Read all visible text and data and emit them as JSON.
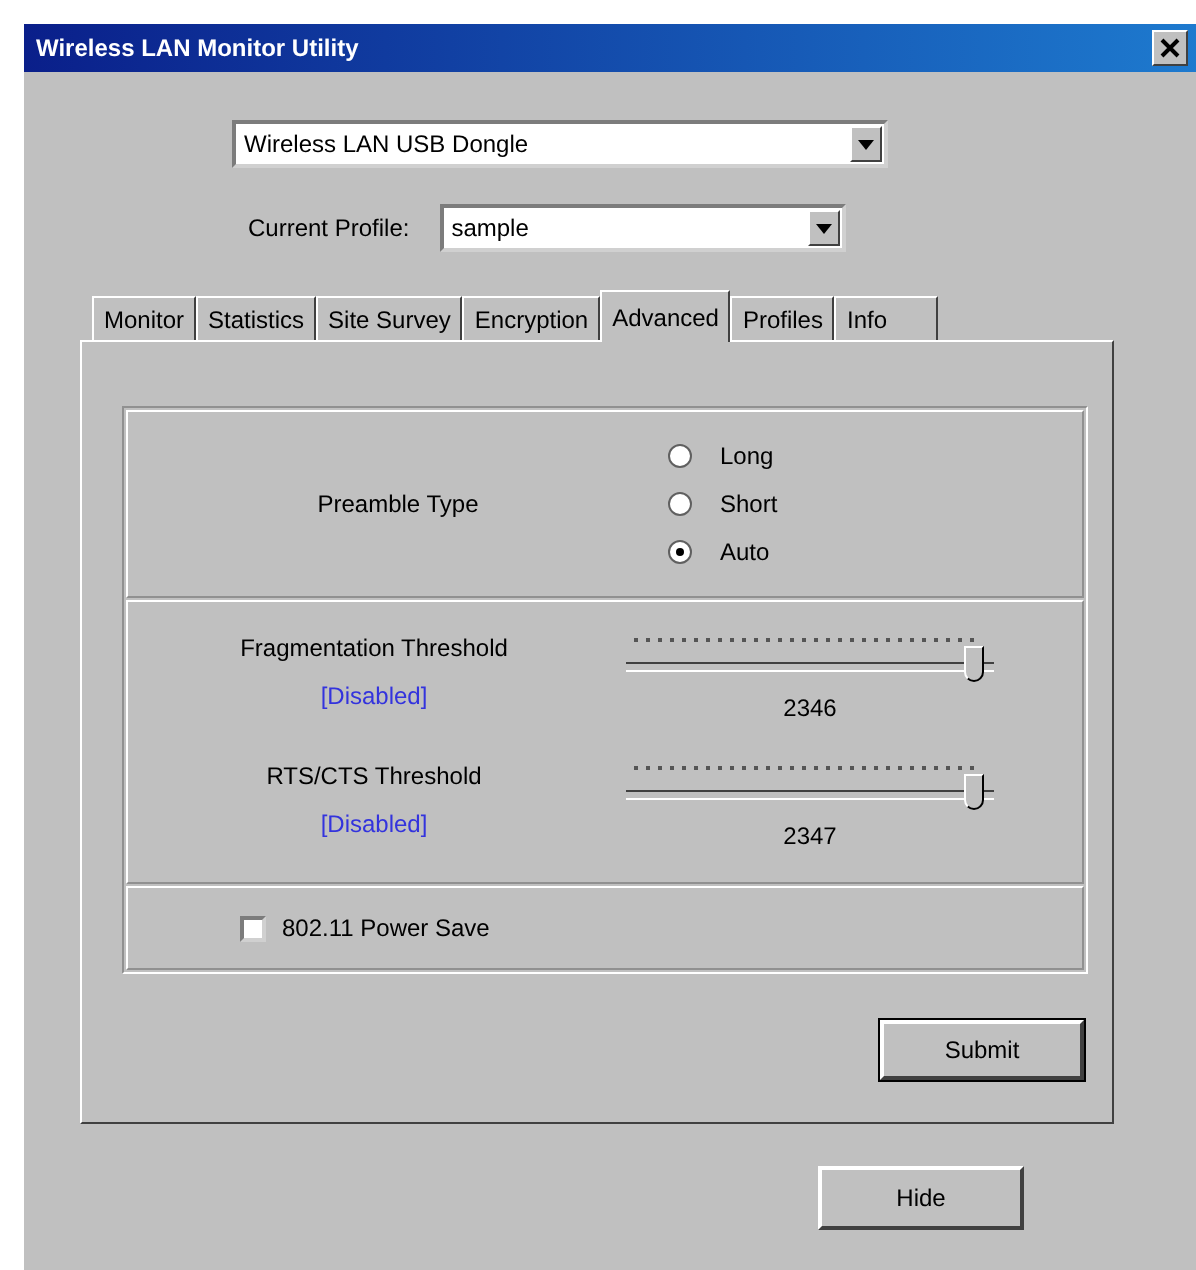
{
  "window": {
    "title": "Wireless LAN Monitor Utility"
  },
  "device": {
    "value": "Wireless LAN USB Dongle"
  },
  "profile": {
    "label": "Current Profile:",
    "value": "sample"
  },
  "tabs": [
    {
      "label": "Monitor",
      "selected": false
    },
    {
      "label": "Statistics",
      "selected": false
    },
    {
      "label": "Site Survey",
      "selected": false
    },
    {
      "label": "Encryption",
      "selected": false
    },
    {
      "label": "Advanced",
      "selected": true
    },
    {
      "label": "Profiles",
      "selected": false
    },
    {
      "label": "Info",
      "selected": false
    }
  ],
  "preamble": {
    "label": "Preamble Type",
    "options": [
      {
        "label": "Long",
        "selected": false
      },
      {
        "label": "Short",
        "selected": false
      },
      {
        "label": "Auto",
        "selected": true
      }
    ]
  },
  "thresholds": [
    {
      "label": "Fragmentation Threshold",
      "status": "[Disabled]",
      "level": 0.98,
      "reading": "2346"
    },
    {
      "label": "RTS/CTS Threshold",
      "status": "[Disabled]",
      "level": 0.98,
      "reading": "2347"
    }
  ],
  "power_save": {
    "label": "802.11 Power Save",
    "checked": false
  },
  "buttons": {
    "submit": "Submit",
    "hide": "Hide"
  }
}
